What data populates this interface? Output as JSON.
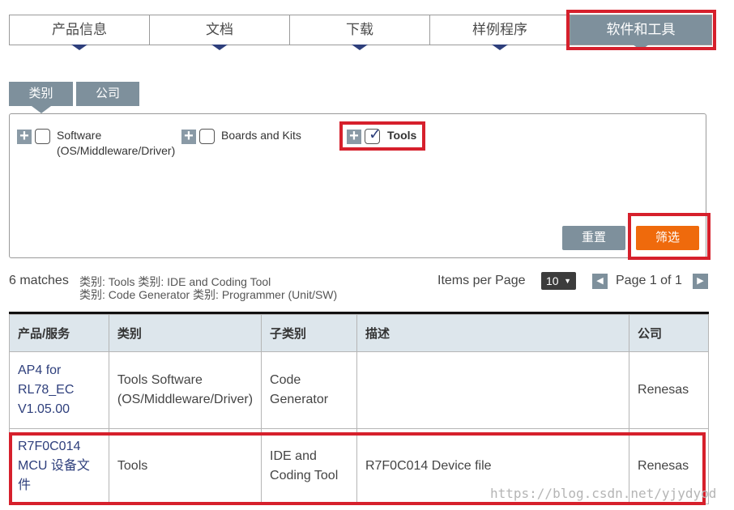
{
  "top_tabs": [
    {
      "label": "产品信息"
    },
    {
      "label": "文档"
    },
    {
      "label": "下载"
    },
    {
      "label": "样例程序"
    },
    {
      "label": "软件和工具"
    }
  ],
  "filter_tabs": [
    {
      "label": "类别"
    },
    {
      "label": "公司"
    }
  ],
  "categories": [
    {
      "label_line1": "Software",
      "label_line2": "(OS/Middleware/Driver)",
      "checked": false
    },
    {
      "label_line1": "Boards and Kits",
      "label_line2": "",
      "checked": false
    },
    {
      "label_line1": "Tools",
      "label_line2": "",
      "checked": true
    }
  ],
  "buttons": {
    "reset": "重置",
    "filter": "筛选"
  },
  "results": {
    "matches": "6 matches",
    "criteria_line1": "类别: Tools   类别: IDE and Coding Tool",
    "criteria_line2": "类别: Code Generator   类别: Programmer (Unit/SW)",
    "items_per_page_label": "Items per Page",
    "items_per_page_value": "10",
    "page_text": "Page 1 of 1"
  },
  "table": {
    "headers": [
      "产品/服务",
      "类别",
      "子类别",
      "描述",
      "公司"
    ],
    "rows": [
      {
        "product": "AP4 for RL78_EC V1.05.00",
        "category": "Tools Software (OS/Middleware/Driver)",
        "subcategory": "Code Generator",
        "description": "",
        "company": "Renesas"
      },
      {
        "product": "R7F0C014 MCU 设备文件",
        "category": "Tools",
        "subcategory": "IDE and Coding Tool",
        "description": "R7F0C014 Device file",
        "company": "Renesas"
      }
    ]
  },
  "watermark": "https://blog.csdn.net/yjydyod",
  "colors": {
    "tab_accent": "#7e909c",
    "filter_button": "#ef6a0c",
    "highlight_frame": "#d6202c",
    "link": "#2e3f7c",
    "table_header_bg": "#dde6ec"
  }
}
